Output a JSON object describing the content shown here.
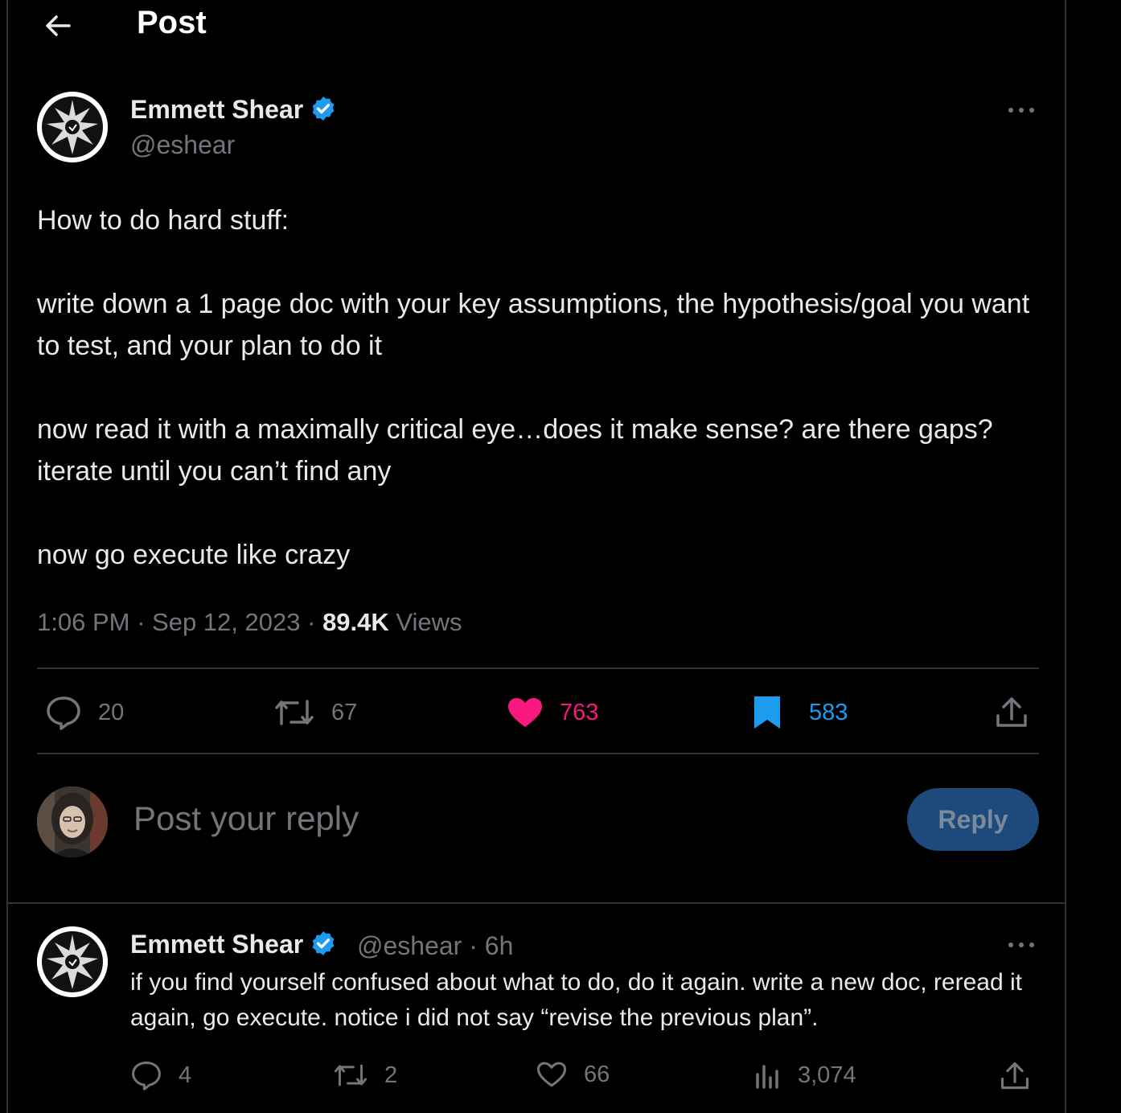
{
  "header": {
    "title": "Post"
  },
  "tweet": {
    "author_name": "Emmett Shear",
    "author_handle": "@eshear",
    "paragraphs": [
      "How to do hard stuff:",
      "write down a 1 page doc with your key assumptions, the hypothesis/goal you want to test, and your plan to do it",
      "now read it with a maximally critical eye…does it make sense? are there gaps? iterate until you can’t find any",
      "now go execute like crazy"
    ],
    "time": "1:06 PM",
    "date": "Sep 12, 2023",
    "views_count": "89.4K",
    "views_label": "Views",
    "dot": "·",
    "actions": {
      "replies": "20",
      "reposts": "67",
      "likes": "763",
      "bookmarks": "583"
    },
    "colors": {
      "like": "#f91880",
      "bookmark": "#1d9bf0",
      "verified": "#1d9bf0"
    }
  },
  "composer": {
    "placeholder": "Post your reply",
    "button_label": "Reply"
  },
  "reply": {
    "author_name": "Emmett Shear",
    "author_handle": "@eshear",
    "age": "· 6h",
    "text": "if you find yourself confused about what to do, do it again. write a new doc, reread it again, go execute. notice i did not say “revise the previous plan”.",
    "actions": {
      "replies": "4",
      "reposts": "2",
      "likes": "66",
      "views": "3,074"
    }
  }
}
